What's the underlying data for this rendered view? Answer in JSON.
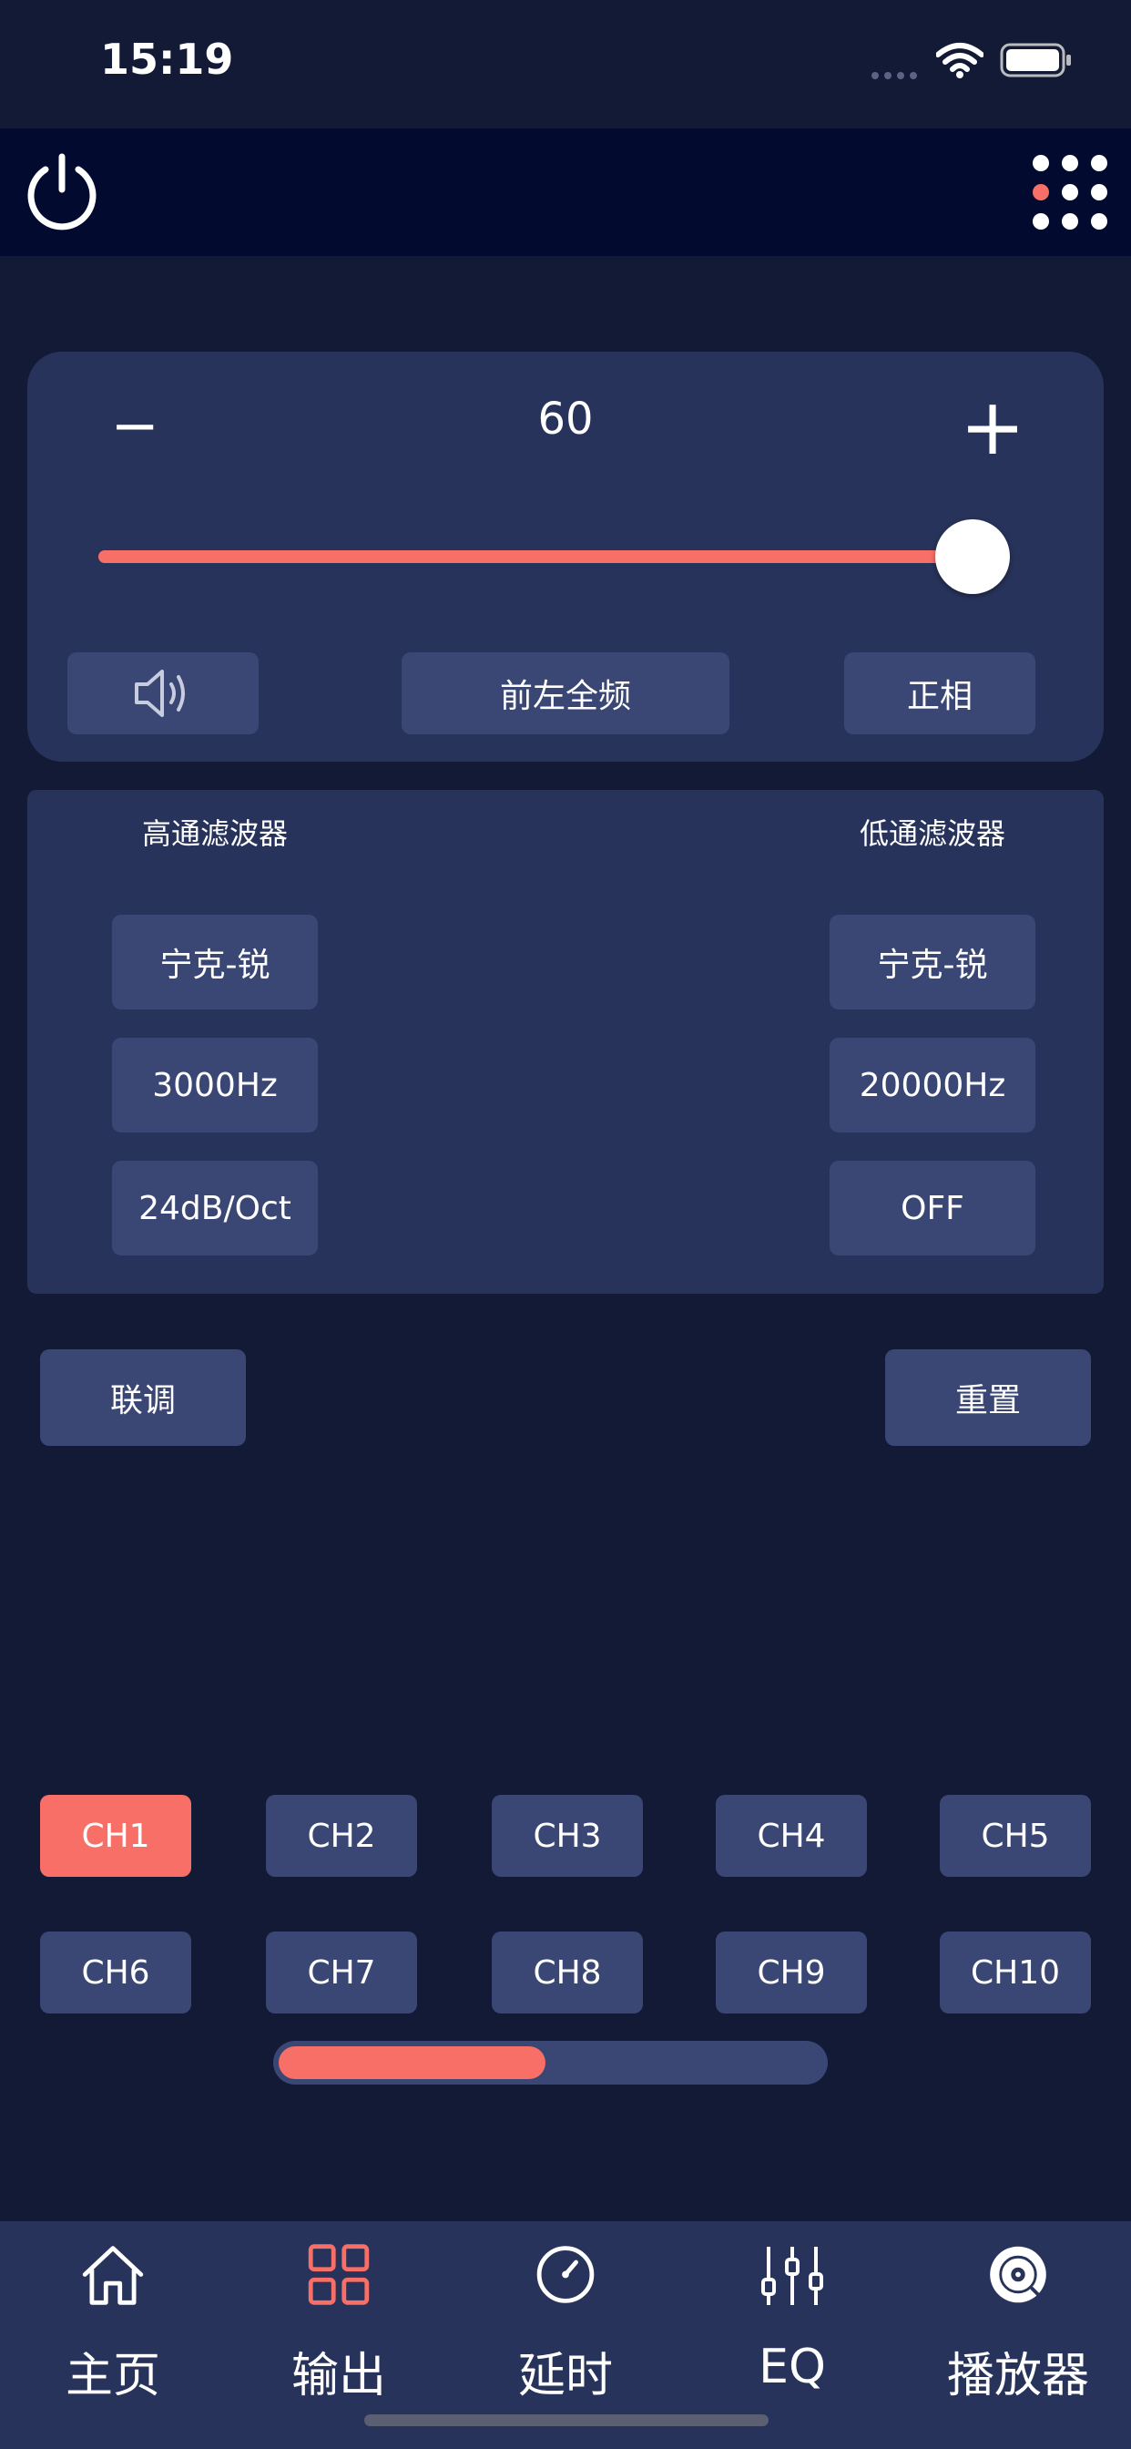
{
  "status_bar": {
    "time": "15:19"
  },
  "volume": {
    "value": "60",
    "minus_label": "−",
    "plus_label": "+",
    "level": 0.96
  },
  "controls": {
    "channel_name": "前左全频",
    "phase": "正相"
  },
  "filters": {
    "high_pass": {
      "title": "高通滤波器",
      "type": "宁克-锐",
      "freq": "3000Hz",
      "slope": "24dB/Oct"
    },
    "low_pass": {
      "title": "低通滤波器",
      "type": "宁克-锐",
      "freq": "20000Hz",
      "slope": "OFF"
    }
  },
  "actions": {
    "link": "联调",
    "reset": "重置"
  },
  "channels": [
    "CH1",
    "CH2",
    "CH3",
    "CH4",
    "CH5",
    "CH6",
    "CH7",
    "CH8",
    "CH9",
    "CH10"
  ],
  "selected_channel": "CH1",
  "page_indicator": {
    "progress": 0.49
  },
  "tabs": [
    {
      "label": "主页",
      "icon": "home-icon"
    },
    {
      "label": "输出",
      "icon": "grid-icon"
    },
    {
      "label": "延时",
      "icon": "gauge-icon"
    },
    {
      "label": "EQ",
      "icon": "equalizer-icon"
    },
    {
      "label": "播放器",
      "icon": "vinyl-icon"
    }
  ],
  "colors": {
    "accent": "#f86f67",
    "button": "#3a4774",
    "card": "#27335a",
    "background": "#131a36",
    "topbar": "#020a30"
  }
}
